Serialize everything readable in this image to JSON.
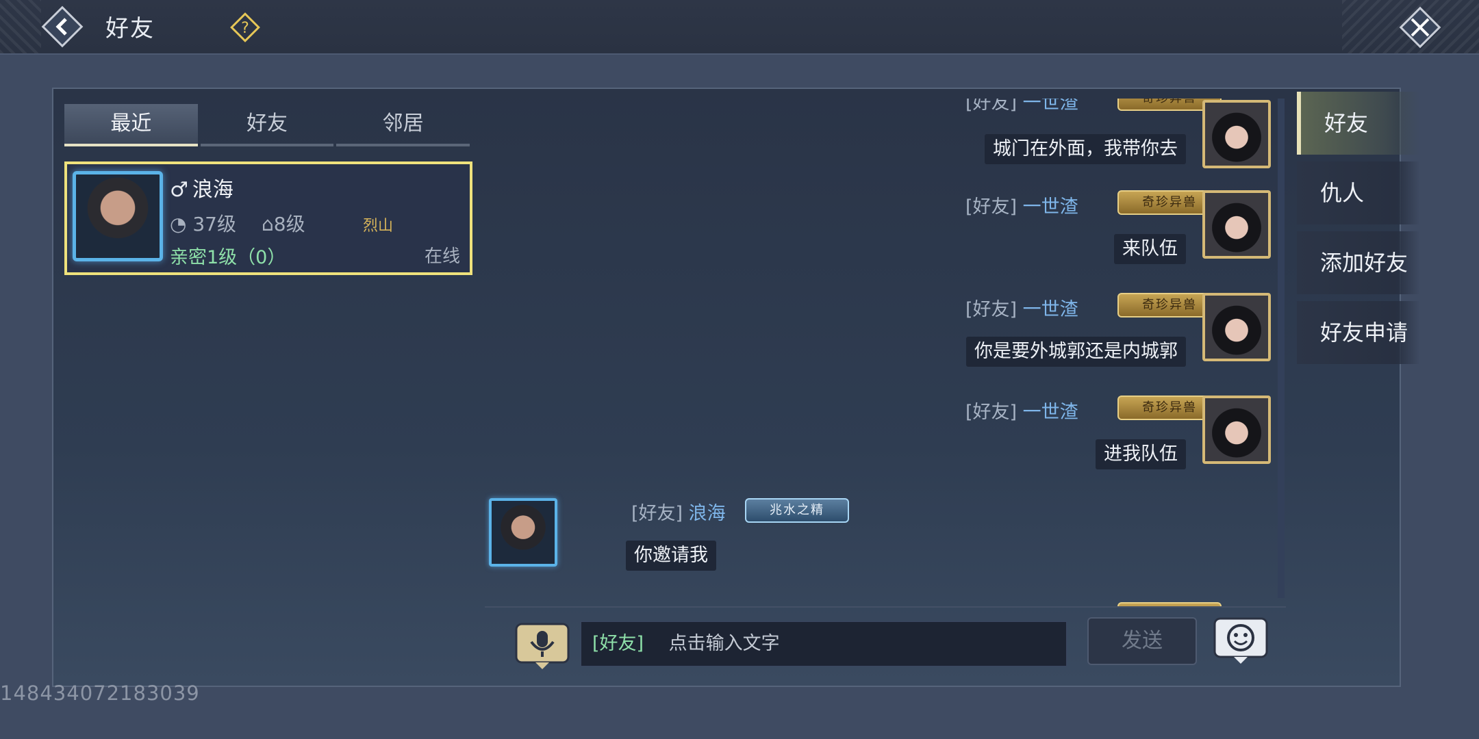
{
  "header": {
    "title": "好友",
    "back_icon": "back-arrow-icon",
    "help_icon": "question-icon",
    "close_icon": "close-icon"
  },
  "list_tabs": [
    {
      "label": "最近",
      "active": true
    },
    {
      "label": "好友",
      "active": false
    },
    {
      "label": "邻居",
      "active": false
    }
  ],
  "friend": {
    "gender_symbol": "♂",
    "name": "浪海",
    "level": "37级",
    "guild_level": "8级",
    "sect": "烈山",
    "intimacy": "亲密1级（0）",
    "status": "在线"
  },
  "messages": [
    {
      "channel": "[好友]",
      "sender": "一世渣",
      "badge": "奇珍异兽",
      "text": "城门在外面，我带你去",
      "side": "right"
    },
    {
      "channel": "[好友]",
      "sender": "一世渣",
      "badge": "奇珍异兽",
      "text": "来队伍",
      "side": "right"
    },
    {
      "channel": "[好友]",
      "sender": "一世渣",
      "badge": "奇珍异兽",
      "text": "你是要外城郭还是内城郭",
      "side": "right"
    },
    {
      "channel": "[好友]",
      "sender": "一世渣",
      "badge": "奇珍异兽",
      "text": "进我队伍",
      "side": "right"
    },
    {
      "channel": "[好友]",
      "sender": "浪海",
      "badge": "兆水之精",
      "text": "你邀请我",
      "side": "left"
    }
  ],
  "input": {
    "channel": "[好友]",
    "placeholder": "点击输入文字",
    "send_label": "发送"
  },
  "side_tabs": [
    {
      "label": "好友",
      "active": true
    },
    {
      "label": "仇人",
      "active": false
    },
    {
      "label": "添加好友",
      "active": false
    },
    {
      "label": "好友申请",
      "active": false
    }
  ],
  "watermark": "148434072183039",
  "colors": {
    "accent_yellow": "#efe27c",
    "name_blue": "#7fb6ea",
    "intimacy_green": "#8ee0a9"
  }
}
